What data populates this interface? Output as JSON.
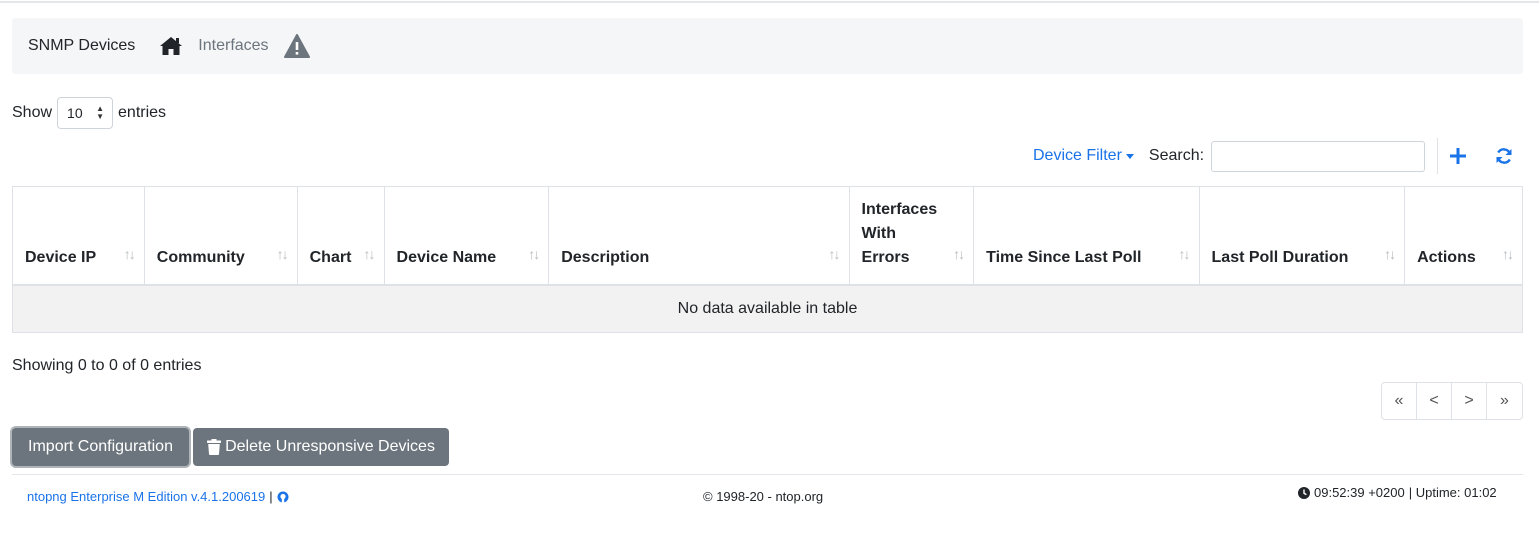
{
  "breadcrumb": {
    "title": "SNMP Devices",
    "home_icon": "home-icon",
    "link": "Interfaces",
    "warning_icon": "warning-icon"
  },
  "length_menu": {
    "show_label": "Show",
    "value": "10",
    "entries_label": "entries"
  },
  "toolbar": {
    "device_filter": "Device Filter",
    "search_label": "Search:",
    "search_value": "",
    "add_icon": "plus-icon",
    "refresh_icon": "refresh-icon"
  },
  "table": {
    "columns": [
      "Device IP",
      "Community",
      "Chart",
      "Device Name",
      "Description",
      "Interfaces With Errors",
      "Time Since Last Poll",
      "Last Poll Duration",
      "Actions"
    ],
    "empty_message": "No data available in table"
  },
  "info": "Showing 0 to 0 of 0 entries",
  "pagination": [
    "«",
    "<",
    ">",
    "»"
  ],
  "buttons": {
    "import": "Import Configuration",
    "delete": "Delete Unresponsive Devices"
  },
  "footer": {
    "edition": "ntopng Enterprise M Edition v.4.1.200619",
    "separator": "|",
    "copyright": "© 1998-20 - ntop.org",
    "time": "09:52:39 +0200",
    "uptime": "| Uptime: 01:02"
  },
  "colors": {
    "link": "#1a73e8",
    "button": "#6c757d",
    "crumb_bg": "#f5f6f8"
  }
}
